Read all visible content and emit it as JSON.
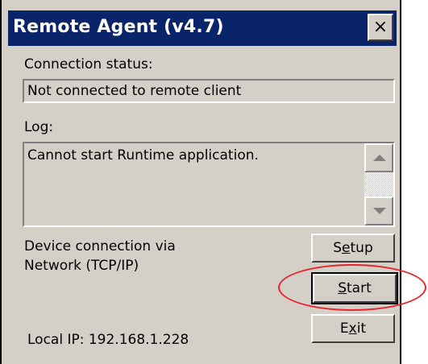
{
  "window": {
    "title": "Remote Agent (v4.7)",
    "close_label": "×"
  },
  "connection": {
    "label": "Connection status:",
    "value": "Not connected to remote client"
  },
  "log": {
    "label": "Log:",
    "text": "Cannot start Runtime application."
  },
  "device": {
    "line1": "Device connection via",
    "line2": "Network (TCP/IP)"
  },
  "local_ip": "Local IP: 192.168.1.228",
  "buttons": {
    "setup_pre": "S",
    "setup_ul": "e",
    "setup_post": "tup",
    "start_pre": "",
    "start_ul": "S",
    "start_post": "tart",
    "exit_pre": "E",
    "exit_ul": "x",
    "exit_post": "it"
  },
  "colors": {
    "titlebar": "#0a246a",
    "window_face": "#d4d0c8",
    "annotation": "#e8232b"
  },
  "icons": [
    "close-icon",
    "scroll-up-arrow-icon",
    "scroll-down-arrow-icon"
  ]
}
